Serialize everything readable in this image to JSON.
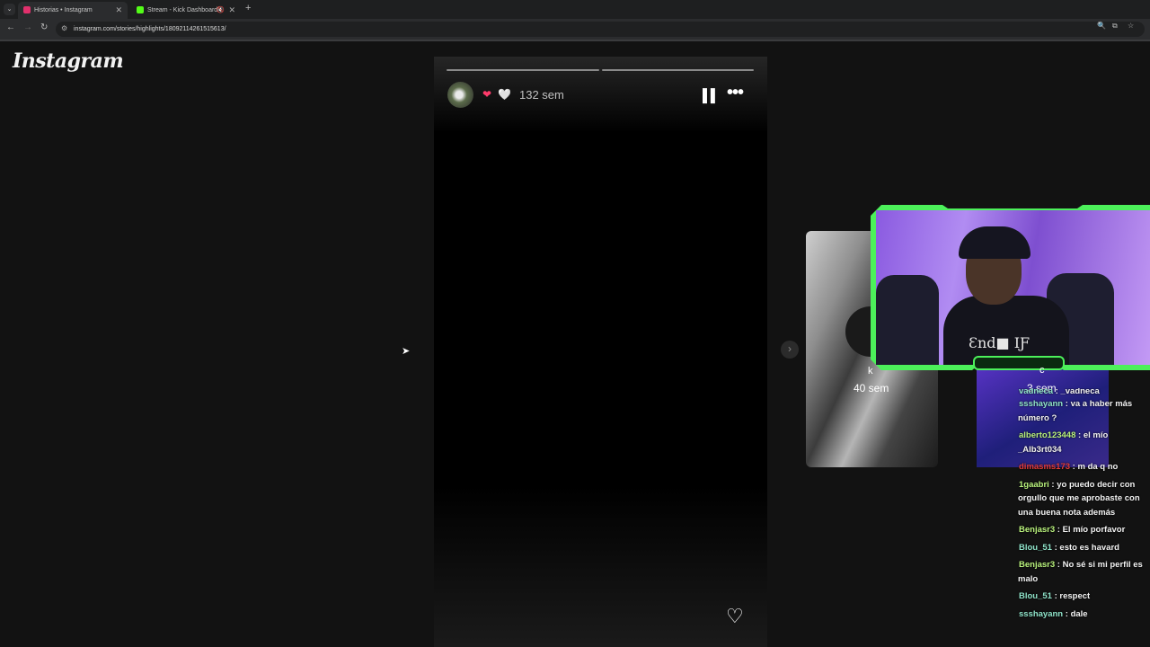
{
  "browser": {
    "tabs": [
      {
        "title": "Historias • Instagram",
        "favicon_color": "#e1306c",
        "active": true
      },
      {
        "title": "Stream - Kick Dashboard",
        "favicon_color": "#53fc18",
        "active": false
      }
    ],
    "url": "instagram.com/stories/highlights/18092114261515613/"
  },
  "page": {
    "logo": "Instagram",
    "story": {
      "reactions": [
        "❤",
        "🤍"
      ],
      "time": "132 sem"
    },
    "previews": [
      {
        "name": "k",
        "time": "40 sem"
      },
      {
        "name": "c",
        "time": "3 sem"
      }
    ]
  },
  "overlay": {
    "shirt_text": "Ɛnd■ IƑ",
    "chat": [
      {
        "user": "vadneca",
        "text": " : _vadneca",
        "color": "#8fe3c9",
        "partial": true
      },
      {
        "user": "ssshayann",
        "text": " : va a haber más número ?",
        "color": "#8fe3c9"
      },
      {
        "user": "alberto123448",
        "text": " : el mío _Alb3rt034",
        "color": "#b9f27c"
      },
      {
        "user": "dimasms173",
        "text": " : m da q no",
        "color": "#e23b3b"
      },
      {
        "user": "1gaabri",
        "text": " : yo puedo decir con orgullo que me aprobaste con una buena nota además",
        "color": "#b9f27c"
      },
      {
        "user": "Benjasr3",
        "text": " : El mío porfavor",
        "color": "#b9f27c"
      },
      {
        "user": "Blou_51",
        "text": " : esto es havard",
        "color": "#8fe3c9"
      },
      {
        "user": "Benjasr3",
        "text": " : No sé si mi perfil es malo",
        "color": "#b9f27c"
      },
      {
        "user": "Blou_51",
        "text": " : respect",
        "color": "#8fe3c9"
      },
      {
        "user": "ssshayann",
        "text": " : dale",
        "color": "#8fe3c9"
      }
    ]
  }
}
